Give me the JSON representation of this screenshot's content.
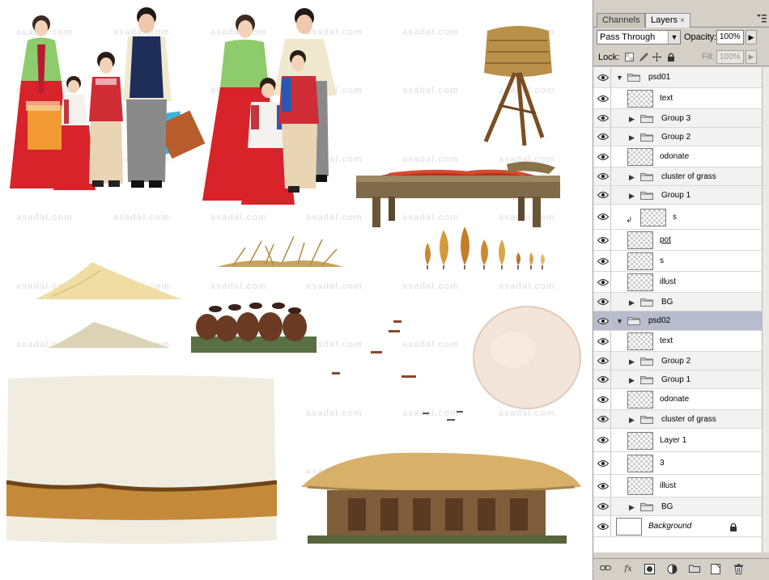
{
  "canvas": {
    "watermark_text": "asadal.com"
  },
  "panel": {
    "tabs": [
      "Channels",
      "Layers"
    ],
    "tab_close_glyph": "×",
    "menu_icon": "panel-menu-icon",
    "blend_mode": "Pass Through",
    "opacity_label": "Opacity:",
    "opacity_value": "100%",
    "lock_label": "Lock:",
    "fill_label": "Fill:",
    "fill_value": "100%",
    "lock_icons": [
      "lock-transparent-icon",
      "lock-paint-icon",
      "lock-move-icon",
      "lock-all-icon"
    ],
    "layers": [
      {
        "name": "psd01",
        "type": "group",
        "level": 0,
        "expanded": true
      },
      {
        "name": "text",
        "type": "layer",
        "level": 1
      },
      {
        "name": "Group 3",
        "type": "group",
        "level": 1,
        "expanded": false
      },
      {
        "name": "Group 2",
        "type": "group",
        "level": 1,
        "expanded": false
      },
      {
        "name": "odonate",
        "type": "layer",
        "level": 1
      },
      {
        "name": "cluster of grass",
        "type": "group",
        "level": 1,
        "expanded": false
      },
      {
        "name": "Group 1",
        "type": "group",
        "level": 1,
        "expanded": false
      },
      {
        "name": "s",
        "type": "layer",
        "level": 1,
        "clipped": true
      },
      {
        "name": "pot",
        "type": "layer",
        "level": 1,
        "underline": true
      },
      {
        "name": "s",
        "type": "layer",
        "level": 1
      },
      {
        "name": "illust",
        "type": "layer",
        "level": 1
      },
      {
        "name": "BG",
        "type": "group",
        "level": 1,
        "expanded": false
      },
      {
        "name": "psd02",
        "type": "group",
        "level": 0,
        "expanded": true,
        "selected": true
      },
      {
        "name": "text",
        "type": "layer",
        "level": 1
      },
      {
        "name": "Group 2",
        "type": "group",
        "level": 1,
        "expanded": false
      },
      {
        "name": "Group 1",
        "type": "group",
        "level": 1,
        "expanded": false
      },
      {
        "name": "odonate",
        "type": "layer",
        "level": 1
      },
      {
        "name": "cluster of grass",
        "type": "group",
        "level": 1,
        "expanded": false
      },
      {
        "name": "Layer 1",
        "type": "layer",
        "level": 1
      },
      {
        "name": "3",
        "type": "layer",
        "level": 1
      },
      {
        "name": "illust",
        "type": "layer",
        "level": 1
      },
      {
        "name": "BG",
        "type": "group",
        "level": 1,
        "expanded": false
      },
      {
        "name": "Background",
        "type": "background",
        "level": 0,
        "locked": true
      }
    ],
    "bottom_icons": [
      "link-layers-icon",
      "layer-style-icon",
      "layer-mask-icon",
      "adjustment-layer-icon",
      "new-group-icon",
      "new-layer-icon",
      "delete-layer-icon"
    ]
  }
}
